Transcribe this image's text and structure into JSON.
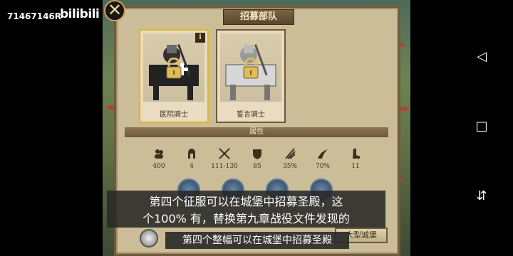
{
  "watermark": {
    "uid": "71467146R",
    "logo": "bilibili"
  },
  "window": {
    "title": "招募部队"
  },
  "close_button": {
    "icon": "close-icon"
  },
  "units": [
    {
      "name": "医院骑士",
      "selected": true,
      "has_info": true,
      "info_label": "i"
    },
    {
      "name": "誓言骑士",
      "selected": false,
      "has_info": false
    }
  ],
  "attributes": {
    "header": "属性",
    "stats": [
      {
        "icon": "troops-icon",
        "value": "400"
      },
      {
        "icon": "helmet-icon",
        "value": "4"
      },
      {
        "icon": "swords-icon",
        "value": "111-130"
      },
      {
        "icon": "shield-icon",
        "value": "85"
      },
      {
        "icon": "claw-icon",
        "value": "35%"
      },
      {
        "icon": "charge-icon",
        "value": "70%"
      },
      {
        "icon": "boot-icon",
        "value": "11"
      }
    ]
  },
  "skills": [
    {
      "icon": "skill-shield-icon"
    },
    {
      "icon": "skill-lance-icon"
    },
    {
      "icon": "skill-castle-icon"
    },
    {
      "icon": "skill-cross-icon"
    }
  ],
  "bottom": {
    "castle_button": "大型城堡"
  },
  "subtitles": {
    "line1": "第四个征服可以在城堡中招募圣殿，这",
    "line2": "个100% 有，替换第九章战役文件发现的",
    "line3": "第四个整幅可以在城堡中招募圣殿"
  },
  "navigation": {
    "back": "back-icon",
    "home": "home-icon",
    "recent": "recent-icon"
  },
  "colors": {
    "gold": "#d6b248",
    "panel": "#cbbd97",
    "frame": "#6d5a3f"
  }
}
